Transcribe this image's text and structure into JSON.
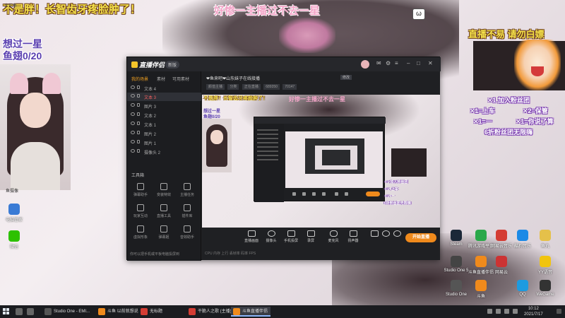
{
  "overlay": {
    "top_left_text": "不是胖！长智齿牙疼脸肿了！",
    "top_mid_text": "好惨一主播过不去一星",
    "top_right_text": "直播不易 请勿白嫖",
    "goal_line1": "想过一星",
    "goal_line2": "鱼翅0/20",
    "small_user": "大伦鱼"
  },
  "gift_rules": [
    "✕1 加入粉丝团",
    "✕1=上车",
    "✕2=保管",
    "✕1=一",
    "✕1=你说了算",
    "6折粉丝团无限嗨"
  ],
  "webcam": {
    "label": "鱼摄像"
  },
  "desktop_icons_left": [
    {
      "label": "电脑管家",
      "color": "#3a7bd5"
    },
    {
      "label": "微信",
      "color": "#2dc100"
    }
  ],
  "desktop_icons_right": [
    {
      "label": "Steam",
      "color": "#1b2838"
    },
    {
      "label": "腾讯游戏平台",
      "color": "#2aa84a"
    },
    {
      "label": "网易云音乐",
      "color": "#d43c33"
    },
    {
      "label": "酷狗音乐",
      "color": "#1b8ae6"
    },
    {
      "label": "鱼丸",
      "color": "#e5c04a"
    },
    {
      "label": "Studio One 5",
      "color": "#444"
    },
    {
      "label": "斗鱼直播伴侣",
      "color": "#f08a1c"
    },
    {
      "label": "网易云",
      "color": "#c33"
    },
    {
      "label": "YY语音",
      "color": "#f1c40f"
    },
    {
      "label": "Studio One",
      "color": "#555"
    },
    {
      "label": "斗鱼",
      "color": "#f08a1c"
    },
    {
      "label": "QQ",
      "color": "#1d9be0"
    },
    {
      "label": "WeGame",
      "color": "#333"
    }
  ],
  "app": {
    "name": "直播伴侣",
    "version": "新版",
    "tabs": [
      "我的场景",
      "素材",
      "可用素材"
    ],
    "layers": [
      {
        "label": "文本 4",
        "active": false
      },
      {
        "label": "文本 3",
        "active": true
      },
      {
        "label": "图片 3",
        "active": false
      },
      {
        "label": "文本 2",
        "active": false
      },
      {
        "label": "文本 1",
        "active": false
      },
      {
        "label": "图片 2",
        "active": false
      },
      {
        "label": "图片 1",
        "active": false
      },
      {
        "label": "摄像头 2",
        "active": false
      }
    ],
    "tools_title": "工具箱",
    "tools": [
      "弹幕助手",
      "变装特效",
      "主播任务",
      "玩家互动",
      "直播工具",
      "插件库",
      "虚拟形象",
      "弹幕姬",
      "音效助手"
    ],
    "left_footer": "你可以把手机或平板电脑投屏到",
    "room_title": "❤鱼来吧❤山东妹子在线接播",
    "room_tag": "修改",
    "room_sub": [
      "颜值主播",
      "分类",
      "正在直播"
    ],
    "room_stats": "689350",
    "room_count": "70147",
    "preview_text1": "不是胖！长智齿牙疼脸肿了！",
    "preview_text2": "好惨一主播过不去一星",
    "preview_goal1": "想过一星",
    "preview_goal2": "鱼翅0/20",
    "bottom_buttons": [
      "直播画面",
      "摄像头",
      "手机投屏",
      "录屏",
      "麦克风",
      "扬声器"
    ],
    "go_live": "开始直播",
    "bottom_stats": "CPU  内存  上行  丢帧率  码率  FPS"
  },
  "taskbar": {
    "items": [
      {
        "label": "Studio One - EMI...",
        "color": "#555",
        "active": false
      },
      {
        "label": "斗鱼 以前就想说",
        "color": "#f08a1c",
        "active": false
      },
      {
        "label": "无标题",
        "color": "#d43c33",
        "active": false
      },
      {
        "label": "干脆人之歌 (主播)",
        "color": "#d43c33",
        "active": false
      },
      {
        "label": "斗鱼直播伴侣",
        "color": "#f08a1c",
        "active": true
      }
    ],
    "time": "10:12",
    "date": "2021/7/17"
  }
}
